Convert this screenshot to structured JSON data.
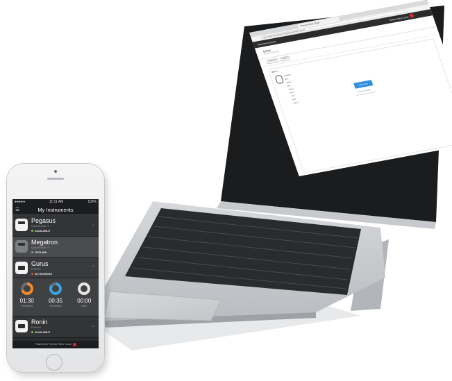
{
  "phone": {
    "status_left": "●●●●● ",
    "status_time": "11:11 AM",
    "status_right": "100%",
    "menu_icon": "menu-icon",
    "title": "My Instruments",
    "instruments": [
      {
        "name": "Pegasus",
        "model": "QuantStudio 3",
        "state": "AVAILABLE",
        "state_color": "#7cc24a"
      },
      {
        "name": "Megatron",
        "model": "QuantStudio 5",
        "state": "OFFLINE",
        "state_color": "#9a9a9a"
      },
      {
        "name": "Gurus",
        "model": "ProFlex",
        "state": "3/3 RUNNING",
        "state_color": "#e0523a"
      },
      {
        "name": "Ronin",
        "model": "ProFlex",
        "state": "AVAILABLE",
        "state_color": "#7cc24a"
      }
    ],
    "timers": [
      {
        "value": "01:30",
        "label": "Remaining",
        "color": "#f0892a",
        "fraction": 0.7
      },
      {
        "value": "00:35",
        "label": "Remaining",
        "color": "#3aa3dd",
        "fraction": 0.85
      },
      {
        "value": "00:00",
        "label": "Open",
        "color": "#e6e6e6",
        "fraction": 1.0
      }
    ],
    "footer": "Powered by Thermo Fisher Cloud"
  },
  "laptop": {
    "tab_title": "Thermo Fisher Cloud",
    "url": "https://apps.thermofisher.com/apps/instrument-connect",
    "nav_left": "Instrument Connect",
    "nav_right": "Thermo Fisher Cloud",
    "page_title": "Gurus",
    "page_subtitle": "ProFlex 3 x 32-well",
    "toolbar_buttons": [
      "Overview",
      "Blocks"
    ],
    "section_label": "Block 1",
    "list_items": [
      "Sample 1",
      "Run",
      "Step 1",
      "95°C",
      "Step 2",
      "60°C",
      "72°C",
      "Hold",
      "Step 3"
    ],
    "primary_button": "Start Run",
    "link_text": "View Run Details",
    "sub_text": "Last updated a few seconds ago"
  }
}
